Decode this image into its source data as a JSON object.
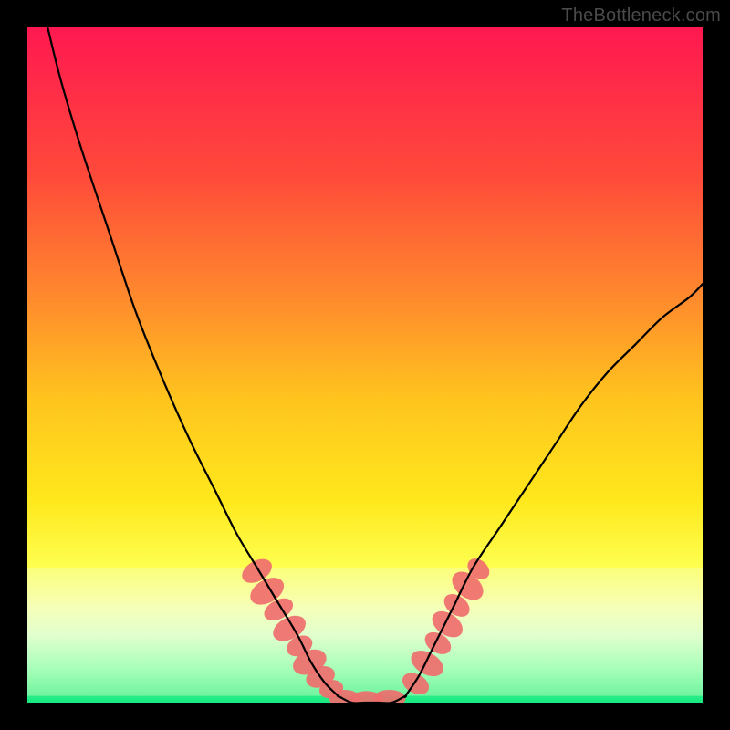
{
  "watermark": "TheBottleneck.com",
  "chart_data": {
    "type": "line",
    "title": "",
    "xlabel": "",
    "ylabel": "",
    "xlim": [
      0,
      100
    ],
    "ylim": [
      0,
      100
    ],
    "grid": false,
    "background_gradient": {
      "stops": [
        {
          "y": 0,
          "color": "#ff1850"
        },
        {
          "y": 22,
          "color": "#ff4a3a"
        },
        {
          "y": 40,
          "color": "#ff8a2d"
        },
        {
          "y": 55,
          "color": "#ffc41e"
        },
        {
          "y": 70,
          "color": "#ffe81c"
        },
        {
          "y": 80,
          "color": "#feff50"
        },
        {
          "y": 86,
          "color": "#f6ffb0"
        },
        {
          "y": 90,
          "color": "#d6ffd0"
        },
        {
          "y": 95,
          "color": "#7dffb0"
        },
        {
          "y": 100,
          "color": "#15e97f"
        }
      ]
    },
    "pale_band": {
      "y_top": 80,
      "y_bottom": 99,
      "color": "#f7ffc8"
    },
    "series": [
      {
        "name": "left-curve",
        "stroke": "#000000",
        "stroke_width": 2.2,
        "x": [
          3,
          5,
          8,
          12,
          16,
          20,
          24,
          28,
          31,
          34,
          37,
          40,
          42,
          44,
          46
        ],
        "y": [
          0,
          8,
          18,
          30,
          42,
          52,
          61,
          69,
          75,
          80,
          85,
          90,
          94,
          97,
          99
        ]
      },
      {
        "name": "valley-floor",
        "stroke": "#000000",
        "stroke_width": 2.2,
        "x": [
          46,
          48,
          50,
          52,
          54,
          56
        ],
        "y": [
          99,
          100,
          100,
          100,
          100,
          99
        ]
      },
      {
        "name": "right-curve",
        "stroke": "#000000",
        "stroke_width": 2.2,
        "x": [
          56,
          58,
          60,
          63,
          66,
          70,
          74,
          78,
          82,
          86,
          90,
          94,
          98,
          100
        ],
        "y": [
          99,
          96,
          92,
          86,
          80,
          74,
          68,
          62,
          56,
          51,
          47,
          43,
          40,
          38
        ]
      }
    ],
    "beads": {
      "note": "clusters of salmon ovals along the curve near the valley",
      "fill": "#ef6e6e",
      "groups": [
        {
          "name": "left-cluster",
          "ellipses": [
            {
              "cx": 34.0,
              "cy": 80.5,
              "rx": 1.5,
              "ry": 2.4,
              "rot": 60
            },
            {
              "cx": 35.5,
              "cy": 83.5,
              "rx": 1.7,
              "ry": 2.7,
              "rot": 60
            },
            {
              "cx": 37.2,
              "cy": 86.2,
              "rx": 1.4,
              "ry": 2.3,
              "rot": 62
            },
            {
              "cx": 38.8,
              "cy": 89.0,
              "rx": 1.6,
              "ry": 2.6,
              "rot": 62
            },
            {
              "cx": 40.3,
              "cy": 91.6,
              "rx": 1.4,
              "ry": 2.0,
              "rot": 64
            },
            {
              "cx": 41.8,
              "cy": 94.0,
              "rx": 1.7,
              "ry": 2.6,
              "rot": 66
            },
            {
              "cx": 43.4,
              "cy": 96.2,
              "rx": 1.5,
              "ry": 2.2,
              "rot": 70
            },
            {
              "cx": 45.0,
              "cy": 98.0,
              "rx": 1.3,
              "ry": 1.8,
              "rot": 75
            }
          ]
        },
        {
          "name": "floor-cluster",
          "ellipses": [
            {
              "cx": 47.0,
              "cy": 99.4,
              "rx": 2.3,
              "ry": 1.3,
              "rot": 0
            },
            {
              "cx": 50.2,
              "cy": 99.6,
              "rx": 2.5,
              "ry": 1.3,
              "rot": 0
            },
            {
              "cx": 53.6,
              "cy": 99.4,
              "rx": 2.4,
              "ry": 1.3,
              "rot": 0
            }
          ]
        },
        {
          "name": "right-cluster",
          "ellipses": [
            {
              "cx": 57.5,
              "cy": 97.2,
              "rx": 1.4,
              "ry": 2.1,
              "rot": -62
            },
            {
              "cx": 59.2,
              "cy": 94.2,
              "rx": 1.6,
              "ry": 2.6,
              "rot": -60
            },
            {
              "cx": 60.8,
              "cy": 91.2,
              "rx": 1.4,
              "ry": 2.1,
              "rot": -58
            },
            {
              "cx": 62.2,
              "cy": 88.4,
              "rx": 1.6,
              "ry": 2.5,
              "rot": -56
            },
            {
              "cx": 63.6,
              "cy": 85.6,
              "rx": 1.4,
              "ry": 2.1,
              "rot": -54
            },
            {
              "cx": 65.2,
              "cy": 82.7,
              "rx": 1.7,
              "ry": 2.6,
              "rot": -52
            },
            {
              "cx": 66.8,
              "cy": 80.2,
              "rx": 1.3,
              "ry": 1.8,
              "rot": -50
            }
          ]
        }
      ]
    }
  }
}
